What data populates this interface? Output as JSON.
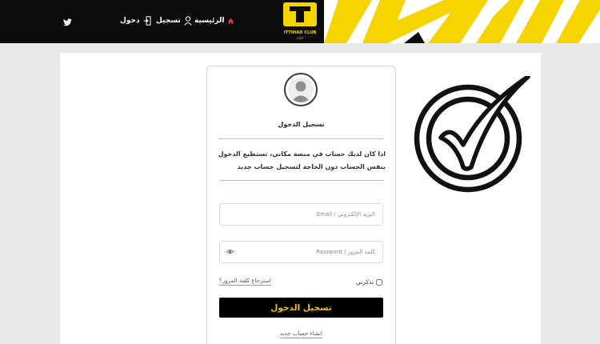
{
  "header": {
    "brand_text": "ITTIHAD CLUB",
    "brand_year": "1927",
    "nav": [
      {
        "label": "الرئيسية",
        "icon": "home-icon"
      },
      {
        "label": "تسجيل",
        "icon": "user-icon"
      },
      {
        "label": "دخول",
        "icon": "login-icon"
      }
    ],
    "social_icon": "twitter-icon",
    "accent_color": "#f5d400"
  },
  "login": {
    "title": "تسجيل الدخول",
    "intro": "اذا كان لديك حساب في منصة مكاني، تستطيع الدخول بنفس الحساب دون الحاجة لتسجيل حساب جديد",
    "email_placeholder": "البريد الإلكتروني / Email",
    "password_placeholder": "كلمة المرور / Password",
    "remember_label": "تذكرني",
    "forgot_label": "استرجاع كلمة المرور؟",
    "submit_label": "تسجيل الدخول",
    "create_account_label": "انشاء حساب جديد"
  },
  "overlay": {
    "icon": "checkmark-circle-icon"
  }
}
